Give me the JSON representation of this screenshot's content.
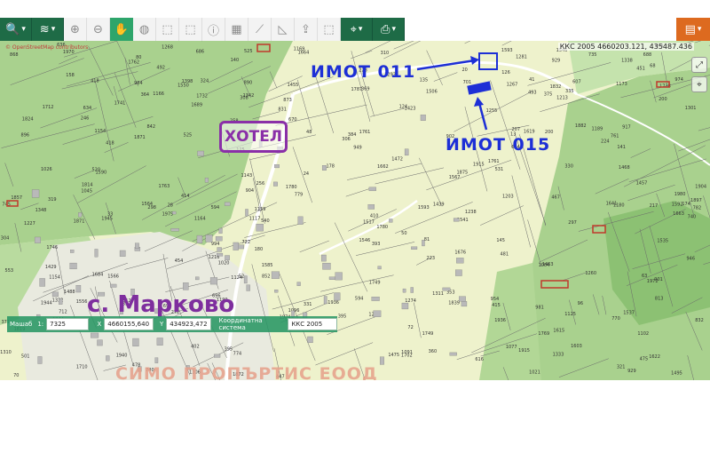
{
  "toolbar": {
    "tools": [
      {
        "icon": "search-icon",
        "glyph": "🔍"
      },
      {
        "icon": "layers-icon",
        "glyph": "≋"
      },
      {
        "icon": "zoom-in-icon",
        "glyph": "⊕"
      },
      {
        "icon": "zoom-out-icon",
        "glyph": "⊖"
      },
      {
        "icon": "pan-hand-icon",
        "glyph": "✋"
      },
      {
        "icon": "globe-icon",
        "glyph": "◍"
      },
      {
        "icon": "select-rect-icon",
        "glyph": "⬚"
      },
      {
        "icon": "select-rect-alt-icon",
        "glyph": "⬚"
      },
      {
        "icon": "info-icon",
        "glyph": "ⓘ"
      },
      {
        "icon": "table-icon",
        "glyph": "▦"
      },
      {
        "icon": "measure-line-icon",
        "glyph": "⟋"
      },
      {
        "icon": "measure-area-icon",
        "glyph": "◺"
      },
      {
        "icon": "upload-icon",
        "glyph": "⇪"
      },
      {
        "icon": "select-clear-icon",
        "glyph": "⬚"
      },
      {
        "icon": "location-icon",
        "glyph": "⌖"
      },
      {
        "icon": "print-icon",
        "glyph": "⎙"
      },
      {
        "icon": "document-icon",
        "glyph": "▤"
      }
    ],
    "accent_dark": "#1e6b46",
    "accent_active": "#2ea56b",
    "accent_orange": "#dd6a1f"
  },
  "map": {
    "coords_readout": "ККС 2005 4660203.121, 435487.436",
    "attribution": "© OpenStreetMap contributors",
    "annotations": {
      "imot_011": "ИМОТ 011",
      "imot_015": "ИМОТ 015",
      "hotel": "ХОТЕЛ",
      "village": "с. Марково",
      "watermark": "СИМО ПРОПЪРТИС ЕООД"
    },
    "colors": {
      "background": "#eef2cc",
      "green_zone": "#a8d08d",
      "parcel_line": "#6b6b6b",
      "annotation_blue": "#1d2fd6",
      "annotation_purple": "#8a2fa8"
    }
  },
  "statusbar": {
    "scale_label": "Машаб",
    "scale_prefix": "1:",
    "scale_value": "7325",
    "x_label": "X",
    "x_value": "4660155,640",
    "y_label": "Y",
    "y_value": "434923,472",
    "crs_label": "Координатна система",
    "crs_value": "ККС 2005"
  }
}
